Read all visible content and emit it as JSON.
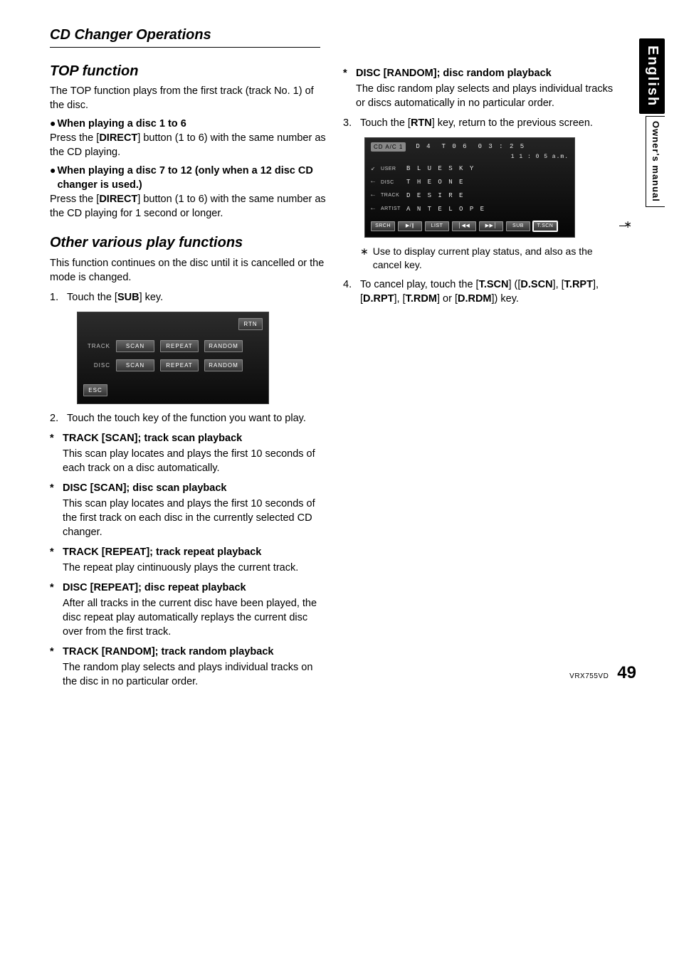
{
  "chapter_title": "CD Changer Operations",
  "side": {
    "lang": "English",
    "owners": "Owner's manual"
  },
  "footer": {
    "model": "VRX755VD",
    "page": "49"
  },
  "left": {
    "top_title": "TOP function",
    "top_para": "The TOP function plays from the first track (track No. 1) of the disc.",
    "bh1": "When playing a disc 1 to 6",
    "bh1_para_a": "Press the [",
    "bh1_para_b": "DIRECT",
    "bh1_para_c": "] button (1 to 6) with the same number as the CD playing.",
    "bh2": "When playing a disc 7 to 12 (only when a 12 disc CD changer is used.)",
    "bh2_para_a": "Press the [",
    "bh2_para_b": "DIRECT",
    "bh2_para_c": "] button (1 to 6) with the same number as the CD playing for 1 second or longer.",
    "other_title": "Other various play functions",
    "other_para": "This function continues on the disc until it is cancelled or the mode is changed.",
    "step1": {
      "num": "1.",
      "a": "Touch the [",
      "b": "SUB",
      "c": "] key."
    },
    "screen1": {
      "rtn": "RTN",
      "row1_label": "TRACK",
      "row2_label": "DISC",
      "scan": "SCAN",
      "repeat": "REPEAT",
      "random": "RANDOM",
      "esc": "ESC"
    },
    "step2": {
      "num": "2.",
      "text": "Touch the touch key of the function you want to play."
    },
    "s1": {
      "head": "TRACK [SCAN]; track scan playback",
      "desc": "This scan play locates and plays the first 10 seconds of each track on a disc automatically."
    },
    "s2": {
      "head": "DISC [SCAN]; disc scan playback",
      "desc": "This scan play locates and plays the first 10 seconds of the first track on each disc in the currently selected CD changer."
    },
    "s3": {
      "head": "TRACK [REPEAT]; track repeat playback",
      "desc": "The repeat play cintinuously plays the current track."
    },
    "s4": {
      "head": "DISC [REPEAT]; disc repeat playback",
      "desc": "After all tracks in the current disc have been played, the disc repeat play automatically replays the current disc over from the first track."
    },
    "s5": {
      "head": "TRACK [RANDOM]; track random playback",
      "desc": "The random play selects and plays individual tracks on the disc in no particular order."
    }
  },
  "right": {
    "s6": {
      "head": "DISC [RANDOM]; disc random playback",
      "desc": "The disc random play selects and plays individual tracks or discs automatically in no particular order."
    },
    "step3": {
      "num": "3.",
      "a": "Touch the [",
      "b": "RTN",
      "c": "] key, return to the previous screen."
    },
    "screen2": {
      "badge": "CD A/C 1",
      "d": "D 4",
      "t": "T 0 6",
      "time": "0 3 : 2 5",
      "clock": "1 1 : 0 5  a.m.",
      "user_label": "USER",
      "user": "B L U E   S K Y",
      "disc_label": "DISC",
      "disc": "T H E   O N E",
      "track_label": "TRACK",
      "track": "D E S I R E",
      "artist_label": "ARTIST",
      "artist": "A N T E L O P E",
      "b1": "SRCH",
      "b2": "▶/∥",
      "b3": "LIST",
      "b4": "│◀◀",
      "b5": "▶▶│",
      "b6": "SUB",
      "b7": "T.SCN"
    },
    "note": {
      "sym": "∗",
      "text": "Use to display current play status, and also as the cancel key."
    },
    "step4": {
      "num": "4.",
      "a": "To cancel play, touch the [",
      "k1": "T.SCN",
      "m1": "] ([",
      "k2": "D.SCN",
      "m2": "], [",
      "k3": "T.RPT",
      "m3": "], [",
      "k4": "D.RPT",
      "m4": "], [",
      "k5": "T.RDM",
      "m5": "] or [",
      "k6": "D.RDM",
      "m6": "]) key."
    }
  }
}
